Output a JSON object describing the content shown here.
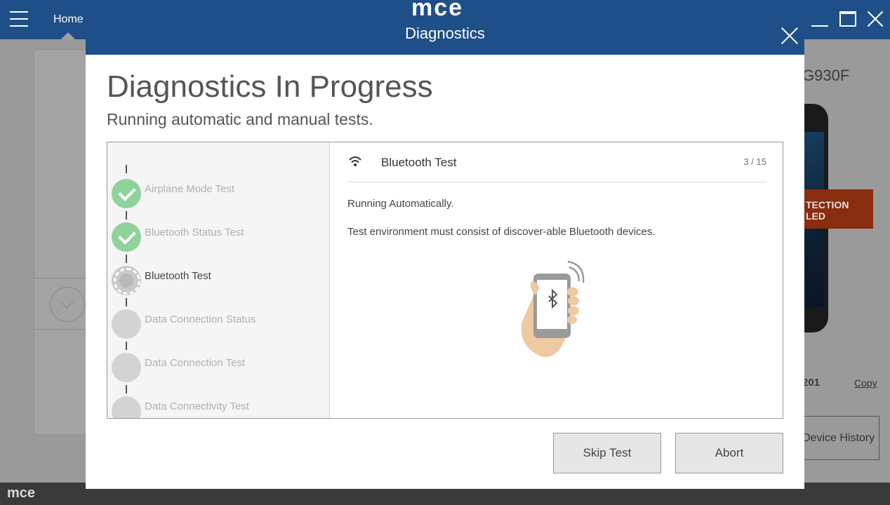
{
  "app": {
    "nav_tab": "Home",
    "brand": "mce",
    "brand_footer": "mce"
  },
  "background": {
    "device_model": "G930F",
    "banner_line1": "TECTION",
    "banner_line2": "LED",
    "serial_fragment": "201",
    "copy_link": "Copy",
    "device_history_button": "Device History"
  },
  "dialog": {
    "title": "Diagnostics",
    "heading": "Diagnostics In Progress",
    "subheading": "Running automatic and manual tests.",
    "tests": [
      {
        "label": "Airplane Mode Test",
        "status": "passed"
      },
      {
        "label": "Bluetooth Status Test",
        "status": "passed"
      },
      {
        "label": "Bluetooth Test",
        "status": "running"
      },
      {
        "label": "Data Connection Status",
        "status": "pending"
      },
      {
        "label": "Data Connection Test",
        "status": "pending"
      },
      {
        "label": "Data Connectivity Test",
        "status": "pending"
      }
    ],
    "current_test": {
      "icon": "wifi-signal-icon",
      "title": "Bluetooth Test",
      "progress": "3 / 15",
      "mode": "Running Automatically.",
      "instructions": "Test environment must consist of discover-able Bluetooth devices.",
      "illustration": "hand-holding-phone-bluetooth"
    },
    "buttons": {
      "skip": "Skip Test",
      "abort": "Abort"
    }
  },
  "colors": {
    "header_blue": "#1e4f88",
    "passed_green": "#8ed39a",
    "pending_gray": "#d3d3d5",
    "banner_red": "#8a2c0e"
  }
}
